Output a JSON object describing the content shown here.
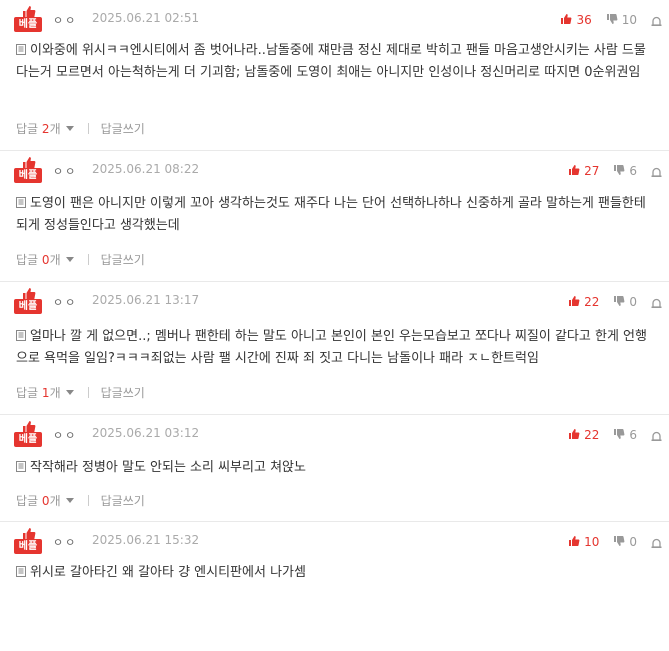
{
  "badge_label": "베플",
  "reply_label": "답글",
  "reply_unit": "개",
  "write_reply_label": "답글쓰기",
  "comments": [
    {
      "nick": "ㅇㅇ",
      "date": "2025.06.21 02:51",
      "up": "36",
      "down": "10",
      "text": "이와중에 위시ㅋㅋ엔시티에서 좀 벗어나라..남돌중에 쟤만큼 정신 제대로 박히고 팬들 마음고생안시키는 사람 드물다는거 모르면서 아는척하는게 더 기괴함; 남돌중에 도영이 최애는 아니지만 인성이나 정신머리로 따지면 0순위권임",
      "replies": "2"
    },
    {
      "nick": "ㅇㅇ",
      "date": "2025.06.21 08:22",
      "up": "27",
      "down": "6",
      "text": "도영이 팬은 아니지만 이렇게 꼬아 생각하는것도 재주다 나는 단어 선택하나하나 신중하게 골라 말하는게 팬들한테 되게 정성들인다고 생각했는데",
      "replies": "0"
    },
    {
      "nick": "ㅇㅇ",
      "date": "2025.06.21 13:17",
      "up": "22",
      "down": "0",
      "text": "얼마나 깔 게 없으면..; 멤버나 팬한테 하는 말도 아니고 본인이 본인 우는모습보고 쪼다나 찌질이 같다고 한게 언행으로 욕먹을 일임?ㅋㅋㅋ죄없는 사람 팰 시간에 진짜 죄 짓고 다니는 남돌이나 패라 ㅈㄴ한트럭임",
      "replies": "1"
    },
    {
      "nick": "ㅇㅇ",
      "date": "2025.06.21 03:12",
      "up": "22",
      "down": "6",
      "text": "작작해라 정병아 말도 안되는 소리 씨부리고 쳐앉노",
      "replies": "0"
    },
    {
      "nick": "ㅇㅇ",
      "date": "2025.06.21 15:32",
      "up": "10",
      "down": "0",
      "text": "위시로 갈아타긴 왜 갈아타 걍 엔시티판에서 나가셈",
      "replies": ""
    }
  ],
  "colors": {
    "accent": "#e5352f",
    "muted": "#999999",
    "date": "#aaaaaa",
    "divider": "#e9e9e9"
  },
  "icons": {
    "badge": "thumbs-up-icon",
    "up": "thumbs-up-icon",
    "down": "thumbs-down-icon",
    "report": "report-icon",
    "text": "document-icon",
    "caret": "caret-down-icon"
  }
}
